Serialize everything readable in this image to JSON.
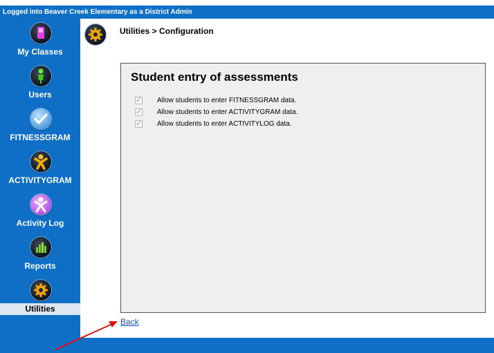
{
  "topbar": {
    "login_text": "Logged into Beaver Creek Elementary as a District Admin"
  },
  "sidebar": {
    "items": [
      {
        "label": "My Classes",
        "icon": "my-classes-icon"
      },
      {
        "label": "Users",
        "icon": "users-icon"
      },
      {
        "label": "FITNESSGRAM",
        "icon": "fitnessgram-check-icon"
      },
      {
        "label": "ACTIVITYGRAM",
        "icon": "activitygram-figure-icon"
      },
      {
        "label": "Activity Log",
        "icon": "activity-log-figure-icon"
      },
      {
        "label": "Reports",
        "icon": "reports-bar-chart-icon"
      },
      {
        "label": "Utilities",
        "icon": "utilities-gear-icon",
        "active": true
      }
    ]
  },
  "main": {
    "breadcrumb": "Utilities > Configuration",
    "panel": {
      "title": "Student entry of assessments",
      "options": [
        {
          "label": "Allow students to enter FITNESSGRAM data.",
          "checked": true,
          "disabled": true
        },
        {
          "label": "Allow students to enter ACTIVITYGRAM data.",
          "checked": true,
          "disabled": true
        },
        {
          "label": "Allow students to enter ACTIVITYLOG data.",
          "checked": true,
          "disabled": true
        }
      ]
    },
    "back_link": "Back"
  },
  "colors": {
    "brand_blue": "#0f6fc6",
    "active_item_bg": "#dde7f2",
    "panel_bg": "#efefef",
    "link": "#1a4fb8",
    "annotation_arrow": "#e01010"
  }
}
